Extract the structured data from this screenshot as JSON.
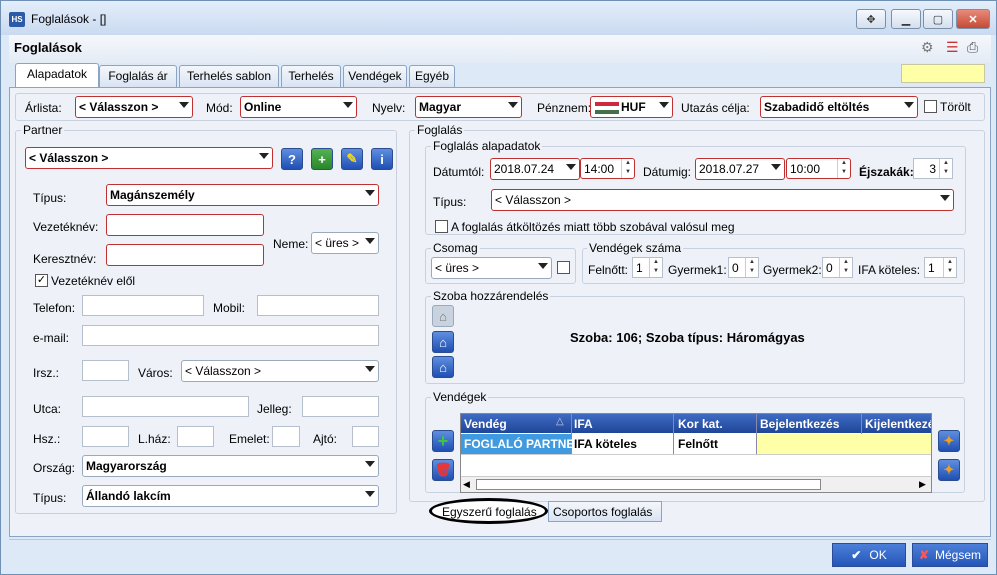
{
  "window": {
    "title": "Foglalások - []",
    "app_icon": "HS"
  },
  "header": {
    "title": "Foglalások"
  },
  "tabs": [
    "Alapadatok",
    "Foglalás ár",
    "Terhelés sablon",
    "Terhelés",
    "Vendégek",
    "Egyéb"
  ],
  "top": {
    "arlista_label": "Árlista:",
    "arlista_value": "< Válasszon >",
    "mod_label": "Mód:",
    "mod_value": "Online",
    "nyelv_label": "Nyelv:",
    "nyelv_value": "Magyar",
    "penznem_label": "Pénznem:",
    "penznem_value": "HUF",
    "utazas_label": "Utazás célja:",
    "utazas_value": "Szabadidő eltöltés",
    "torolt_label": "Törölt"
  },
  "partner": {
    "group_title": "Partner",
    "select_value": "< Válasszon >",
    "tipus_label": "Típus:",
    "tipus_value": "Magánszemély",
    "vezeteknev_label": "Vezetéknév:",
    "keresztnev_label": "Keresztnév:",
    "neme_label": "Neme:",
    "neme_value": "< üres >",
    "vezeteknev_elol_label": "Vezetéknév elől",
    "telefon_label": "Telefon:",
    "mobil_label": "Mobil:",
    "email_label": "e-mail:",
    "irsz_label": "Irsz.:",
    "varos_label": "Város:",
    "varos_value": "< Válasszon >",
    "utca_label": "Utca:",
    "jelleg_label": "Jelleg:",
    "hsz_label": "Hsz.:",
    "lhaz_label": "L.ház:",
    "emelet_label": "Emelet:",
    "ajto_label": "Ajtó:",
    "orszag_label": "Ország:",
    "orszag_value": "Magyarország",
    "tipus2_label": "Típus:",
    "tipus2_value": "Állandó lakcím"
  },
  "foglalas": {
    "group_title": "Foglalás",
    "alap_title": "Foglalás alapadatok",
    "datumtol_label": "Dátumtól:",
    "datumtol_value": "2018.07.24",
    "time_from": "14:00",
    "datumig_label": "Dátumig:",
    "datumig_value": "2018.07.27",
    "time_to": "10:00",
    "ejszakak_label": "Éjszakák:",
    "ejszakak_value": "3",
    "tipus_label": "Típus:",
    "tipus_value": "< Válasszon >",
    "atkoltozes_label": "A foglalás átköltözés miatt több szobával valósul meg",
    "csomag_title": "Csomag",
    "csomag_value": "< üres >",
    "vendegek_szama_title": "Vendégek száma",
    "felnott_label": "Felnőtt:",
    "felnott_value": "1",
    "gyermek1_label": "Gyermek1:",
    "gyermek1_value": "0",
    "gyermek2_label": "Gyermek2:",
    "gyermek2_value": "0",
    "ifa_label": "IFA köteles:",
    "ifa_value": "1",
    "szoba_title": "Szoba hozzárendelés",
    "szoba_text": "Szoba: 106; Szoba típus: Háromágyas",
    "vendegek_title": "Vendégek",
    "table_headers": [
      "Vendég",
      "IFA",
      "Kor kat.",
      "Bejelentkezés",
      "Kijelentkezé"
    ],
    "table_rows": [
      [
        "FOGLALÓ PARTNER",
        "IFA köteles",
        "Felnőtt",
        "",
        ""
      ]
    ]
  },
  "bottom_tabs": [
    "Egyszerű foglalás",
    "Csoportos foglalás"
  ],
  "buttons": {
    "ok": "OK",
    "cancel": "Mégsem"
  }
}
